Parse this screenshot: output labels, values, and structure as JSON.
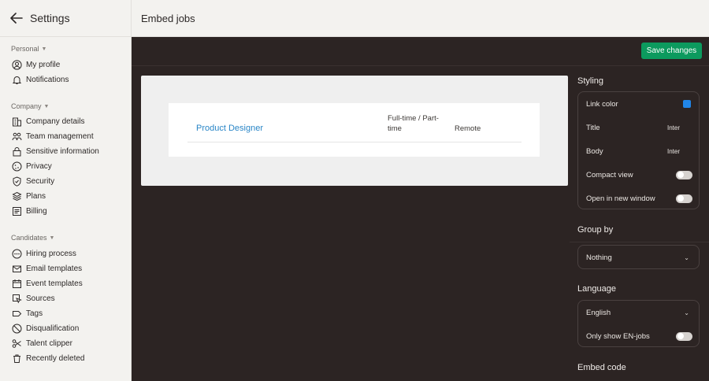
{
  "sidebar": {
    "title": "Settings",
    "groups": {
      "personal": "Personal",
      "company": "Company",
      "candidates": "Candidates"
    },
    "personal_items": [
      "My profile",
      "Notifications"
    ],
    "company_items": [
      "Company details",
      "Team management",
      "Sensitive information",
      "Privacy",
      "Security",
      "Plans",
      "Billing"
    ],
    "candidate_items": [
      "Hiring process",
      "Email templates",
      "Event templates",
      "Sources",
      "Tags",
      "Disqualification",
      "Talent clipper",
      "Recently deleted"
    ]
  },
  "header": {
    "title": "Embed jobs"
  },
  "toolbar": {
    "save_label": "Save changes"
  },
  "preview": {
    "job_title": "Product Designer",
    "job_type": "Full-time / Part-time",
    "job_location": "Remote"
  },
  "styling": {
    "title": "Styling",
    "link_color_label": "Link color",
    "link_color": "#2186e8",
    "title_font_label": "Title",
    "title_font": "Inter",
    "body_font_label": "Body",
    "body_font": "Inter",
    "compact_label": "Compact view",
    "compact_on": false,
    "new_window_label": "Open in new window",
    "new_window_on": false
  },
  "group_by": {
    "title": "Group by",
    "selected": "Nothing"
  },
  "language": {
    "title": "Language",
    "selected": "English",
    "only_show_label": "Only show EN-jobs",
    "only_show_on": false
  },
  "embed_code": {
    "title": "Embed code"
  },
  "colors": {
    "save_button": "#0c9a5e",
    "accent_link": "#2a86c7"
  }
}
